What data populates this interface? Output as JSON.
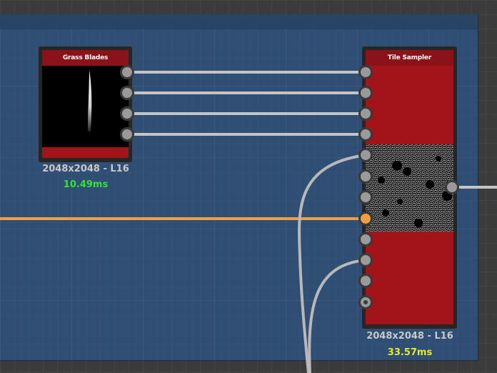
{
  "nodes": {
    "grass_blades": {
      "title": "Grass Blades",
      "resolution": "2048x2048 - L16",
      "time": "10.49ms"
    },
    "tile_sampler": {
      "title": "Tile Sampler",
      "resolution": "2048x2048 - L16",
      "time": "33.57ms"
    }
  },
  "colors": {
    "graph_bg": "#2f4e74",
    "node_red": "#a0141a",
    "wire_gray": "#c0c0c0",
    "wire_orange": "#f0a040",
    "time_fast": "#38e038",
    "time_slow": "#e8e820"
  }
}
